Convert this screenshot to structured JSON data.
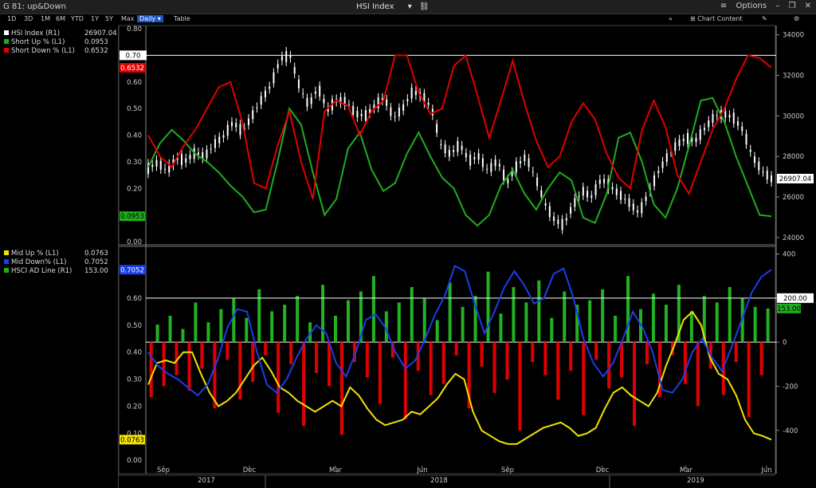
{
  "window": {
    "app_title": "G 81: up&Down",
    "chart_title": "HSI Index",
    "options_label": "Options"
  },
  "toolbar": {
    "ranges": [
      "1D",
      "3D",
      "1M",
      "6M",
      "YTD",
      "1Y",
      "5Y",
      "Max"
    ],
    "frequency": "Daily",
    "table_label": "Table",
    "chart_content_label": "Chart Content"
  },
  "colors": {
    "hsi": "#ffffff",
    "short_up": "#1fae1f",
    "short_down": "#e00000",
    "mid_up": "#f2e200",
    "mid_down": "#1a3ee8",
    "ad_line": "#1fae1f",
    "bars_up": "#22b222",
    "bars_down": "#e00000"
  },
  "legend_top": [
    {
      "name": "HSI Index  (R1)",
      "value": "26907.04",
      "color": "#ffffff"
    },
    {
      "name": "Short Up % (L1)",
      "value": "0.0953",
      "color": "#1fae1f"
    },
    {
      "name": "Short Down % (L1)",
      "value": "0.6532",
      "color": "#e00000"
    }
  ],
  "legend_bottom": [
    {
      "name": "Mid Up % (L1)",
      "value": "0.0763",
      "color": "#f2e200"
    },
    {
      "name": "Mid Down% (L1)",
      "value": "0.7052",
      "color": "#1a3ee8"
    },
    {
      "name": "HSCI AD Line (R1)",
      "value": "153.00",
      "color": "#1fae1f"
    }
  ],
  "tags": {
    "top_hline": "0.70",
    "short_down_last": "0.6532",
    "short_up_last": "0.0953",
    "hsi_last": "26907.04",
    "mid_down_last": "0.7052",
    "mid_up_last": "0.0763",
    "ad_hline": "200.00",
    "ad_last": "153.00"
  },
  "x_axis": {
    "months": [
      "Sep",
      "Dec",
      "Mar",
      "Jun",
      "Sep",
      "Dec",
      "Mar",
      "Jun"
    ],
    "years": [
      "2017",
      "2018",
      "2019"
    ]
  },
  "chart_data": [
    {
      "type": "line",
      "panel": "top",
      "x_range": [
        "2017-08",
        "2019-06"
      ],
      "left_axis": {
        "ticks": [
          "0.00",
          "0.10",
          "0.20",
          "0.30",
          "0.40",
          "0.50",
          "0.60",
          "0.70",
          "0.80"
        ],
        "ylim": [
          0,
          0.8
        ]
      },
      "right_axis": {
        "ticks": [
          "24000",
          "26000",
          "28000",
          "30000",
          "32000",
          "34000"
        ],
        "ylim": [
          23800,
          34300
        ]
      },
      "horizontal_line": 0.7,
      "series": [
        {
          "name": "HSI Index",
          "axis": "right",
          "style": "candlestick",
          "values": [
            27400,
            27700,
            27300,
            27900,
            27800,
            28200,
            28000,
            28600,
            29000,
            29700,
            29200,
            30000,
            30800,
            31500,
            32800,
            33000,
            31500,
            30500,
            31400,
            30300,
            30800,
            30700,
            30100,
            30000,
            30500,
            30900,
            29900,
            30400,
            31200,
            31000,
            30400,
            28600,
            28100,
            28600,
            27800,
            28000,
            27300,
            27800,
            26700,
            27500,
            28000,
            27000,
            25700,
            24900,
            24600,
            25600,
            26300,
            26000,
            26900,
            26500,
            26100,
            25700,
            25200,
            26200,
            27200,
            28000,
            28600,
            28900,
            28800,
            29400,
            30000,
            30100,
            29900,
            29300,
            28000,
            27300,
            26900
          ]
        },
        {
          "name": "Short Up %",
          "axis": "left",
          "values": [
            0.28,
            0.37,
            0.42,
            0.38,
            0.33,
            0.3,
            0.26,
            0.21,
            0.17,
            0.11,
            0.12,
            0.3,
            0.5,
            0.44,
            0.26,
            0.1,
            0.16,
            0.35,
            0.41,
            0.27,
            0.19,
            0.22,
            0.33,
            0.41,
            0.32,
            0.24,
            0.2,
            0.1,
            0.06,
            0.1,
            0.21,
            0.27,
            0.18,
            0.12,
            0.2,
            0.26,
            0.23,
            0.09,
            0.07,
            0.18,
            0.39,
            0.41,
            0.3,
            0.14,
            0.09,
            0.2,
            0.36,
            0.53,
            0.54,
            0.45,
            0.32,
            0.21,
            0.1,
            0.095
          ]
        },
        {
          "name": "Short Down %",
          "axis": "left",
          "values": [
            0.4,
            0.32,
            0.28,
            0.36,
            0.42,
            0.5,
            0.58,
            0.6,
            0.45,
            0.22,
            0.2,
            0.36,
            0.49,
            0.3,
            0.16,
            0.49,
            0.53,
            0.51,
            0.4,
            0.49,
            0.53,
            0.7,
            0.7,
            0.56,
            0.48,
            0.5,
            0.66,
            0.7,
            0.55,
            0.39,
            0.53,
            0.68,
            0.52,
            0.38,
            0.28,
            0.32,
            0.45,
            0.52,
            0.46,
            0.33,
            0.24,
            0.2,
            0.42,
            0.53,
            0.43,
            0.25,
            0.18,
            0.3,
            0.42,
            0.5,
            0.61,
            0.7,
            0.69,
            0.6532
          ]
        }
      ]
    },
    {
      "type": "bar",
      "panel": "bottom",
      "x_range": [
        "2017-08",
        "2019-06"
      ],
      "left_axis": {
        "ticks": [
          "0.00",
          "0.10",
          "0.20",
          "0.30",
          "0.40",
          "0.50",
          "0.60",
          "0.70"
        ],
        "ylim": [
          -0.02,
          0.78
        ]
      },
      "right_axis": {
        "ticks": [
          "-400",
          "-200",
          "0",
          "200",
          "400"
        ],
        "ylim": [
          -560,
          420
        ]
      },
      "horizontal_line": 200,
      "series": [
        {
          "name": "HSCI AD Line",
          "axis": "right",
          "style": "bars",
          "values": [
            -250,
            80,
            -200,
            120,
            -150,
            60,
            -220,
            180,
            -120,
            90,
            -300,
            150,
            -80,
            200,
            -260,
            110,
            -180,
            240,
            -60,
            140,
            -320,
            170,
            -100,
            210,
            -380,
            90,
            -140,
            260,
            -200,
            120,
            -420,
            190,
            -90,
            230,
            -160,
            300,
            -280,
            140,
            -70,
            180,
            -350,
            250,
            -130,
            200,
            -240,
            100,
            -190,
            270,
            -60,
            160,
            -300,
            210,
            -110,
            320,
            -230,
            130,
            -170,
            250,
            -400,
            180,
            -90,
            280,
            -150,
            110,
            -260,
            230,
            -130,
            170,
            -330,
            190,
            -80,
            240,
            -210,
            120,
            -160,
            300,
            -380,
            150,
            -100,
            220,
            -250,
            170,
            -60,
            260,
            -190,
            140,
            -290,
            210,
            -120,
            180,
            -240,
            250,
            -90,
            200,
            -340,
            160,
            -150,
            153
          ]
        },
        {
          "name": "Mid Up %",
          "axis": "left",
          "values": [
            0.28,
            0.36,
            0.37,
            0.36,
            0.4,
            0.4,
            0.32,
            0.25,
            0.2,
            0.22,
            0.25,
            0.3,
            0.35,
            0.38,
            0.33,
            0.27,
            0.25,
            0.22,
            0.2,
            0.18,
            0.2,
            0.22,
            0.2,
            0.27,
            0.24,
            0.19,
            0.15,
            0.13,
            0.14,
            0.15,
            0.18,
            0.17,
            0.2,
            0.23,
            0.28,
            0.32,
            0.3,
            0.18,
            0.11,
            0.09,
            0.07,
            0.06,
            0.06,
            0.08,
            0.1,
            0.12,
            0.13,
            0.14,
            0.12,
            0.09,
            0.1,
            0.12,
            0.19,
            0.25,
            0.27,
            0.24,
            0.22,
            0.2,
            0.25,
            0.35,
            0.43,
            0.52,
            0.55,
            0.5,
            0.38,
            0.32,
            0.3,
            0.24,
            0.15,
            0.1,
            0.09,
            0.0763
          ]
        },
        {
          "name": "Mid Down%",
          "axis": "left",
          "values": [
            0.4,
            0.35,
            0.32,
            0.3,
            0.27,
            0.24,
            0.28,
            0.37,
            0.49,
            0.56,
            0.55,
            0.4,
            0.28,
            0.25,
            0.3,
            0.38,
            0.45,
            0.5,
            0.47,
            0.36,
            0.31,
            0.4,
            0.52,
            0.54,
            0.49,
            0.4,
            0.34,
            0.37,
            0.45,
            0.54,
            0.61,
            0.72,
            0.7,
            0.58,
            0.47,
            0.55,
            0.64,
            0.7,
            0.65,
            0.58,
            0.6,
            0.69,
            0.71,
            0.6,
            0.45,
            0.36,
            0.31,
            0.36,
            0.45,
            0.55,
            0.49,
            0.4,
            0.26,
            0.25,
            0.3,
            0.4,
            0.45,
            0.38,
            0.33,
            0.42,
            0.52,
            0.62,
            0.68,
            0.7052
          ]
        }
      ]
    }
  ]
}
